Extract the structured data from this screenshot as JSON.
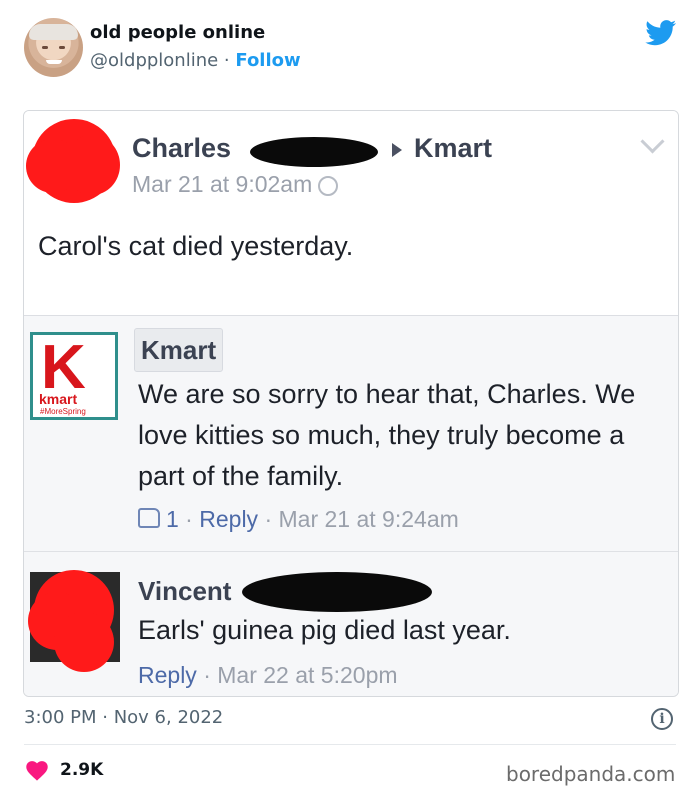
{
  "tweet": {
    "display_name": "old people online",
    "handle": "@oldpplonline",
    "separator": " · ",
    "follow_label": "Follow",
    "timestamp": "3:00 PM · Nov 6, 2022",
    "likes": "2.9K",
    "watermark": "boredpanda.com",
    "accent_color": "#1d9bf0",
    "heart_color": "#f91880"
  },
  "screenshot": {
    "post": {
      "author": "Charles",
      "target": "Kmart",
      "meta": "Mar 21 at 9:02am",
      "text": "Carol's cat died yesterday."
    },
    "kmart_comment": {
      "logo_letter": "K",
      "logo_word": "kmart",
      "logo_tag": "#MoreSpring",
      "name": "Kmart",
      "text": "We are so sorry to hear that, Charles. We love kitties so much, they truly become a part of the family.",
      "like_count": "1",
      "reply_label": "Reply",
      "time": "Mar 21 at 9:24am",
      "dot": " · "
    },
    "vincent_comment": {
      "name": "Vincent",
      "text": "Earls' guinea pig died last year.",
      "reply_label": "Reply",
      "time": "Mar 22 at 5:20pm",
      "dot": " · "
    }
  }
}
